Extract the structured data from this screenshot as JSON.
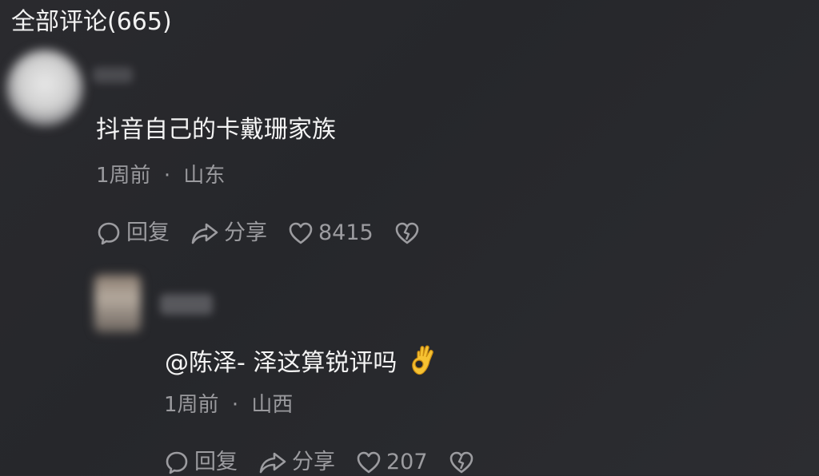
{
  "header": {
    "title": "全部评论(665)"
  },
  "comments": [
    {
      "text": "抖音自己的卡戴珊家族",
      "time": "1周前",
      "location": "山东",
      "reply_label": "回复",
      "share_label": "分享",
      "like_count": "8415"
    },
    {
      "text": "@陈泽- 泽这算锐评吗",
      "emoji": "ok-hand",
      "time": "1周前",
      "location": "山西",
      "reply_label": "回复",
      "share_label": "分享",
      "like_count": "207"
    }
  ],
  "separator": "·"
}
